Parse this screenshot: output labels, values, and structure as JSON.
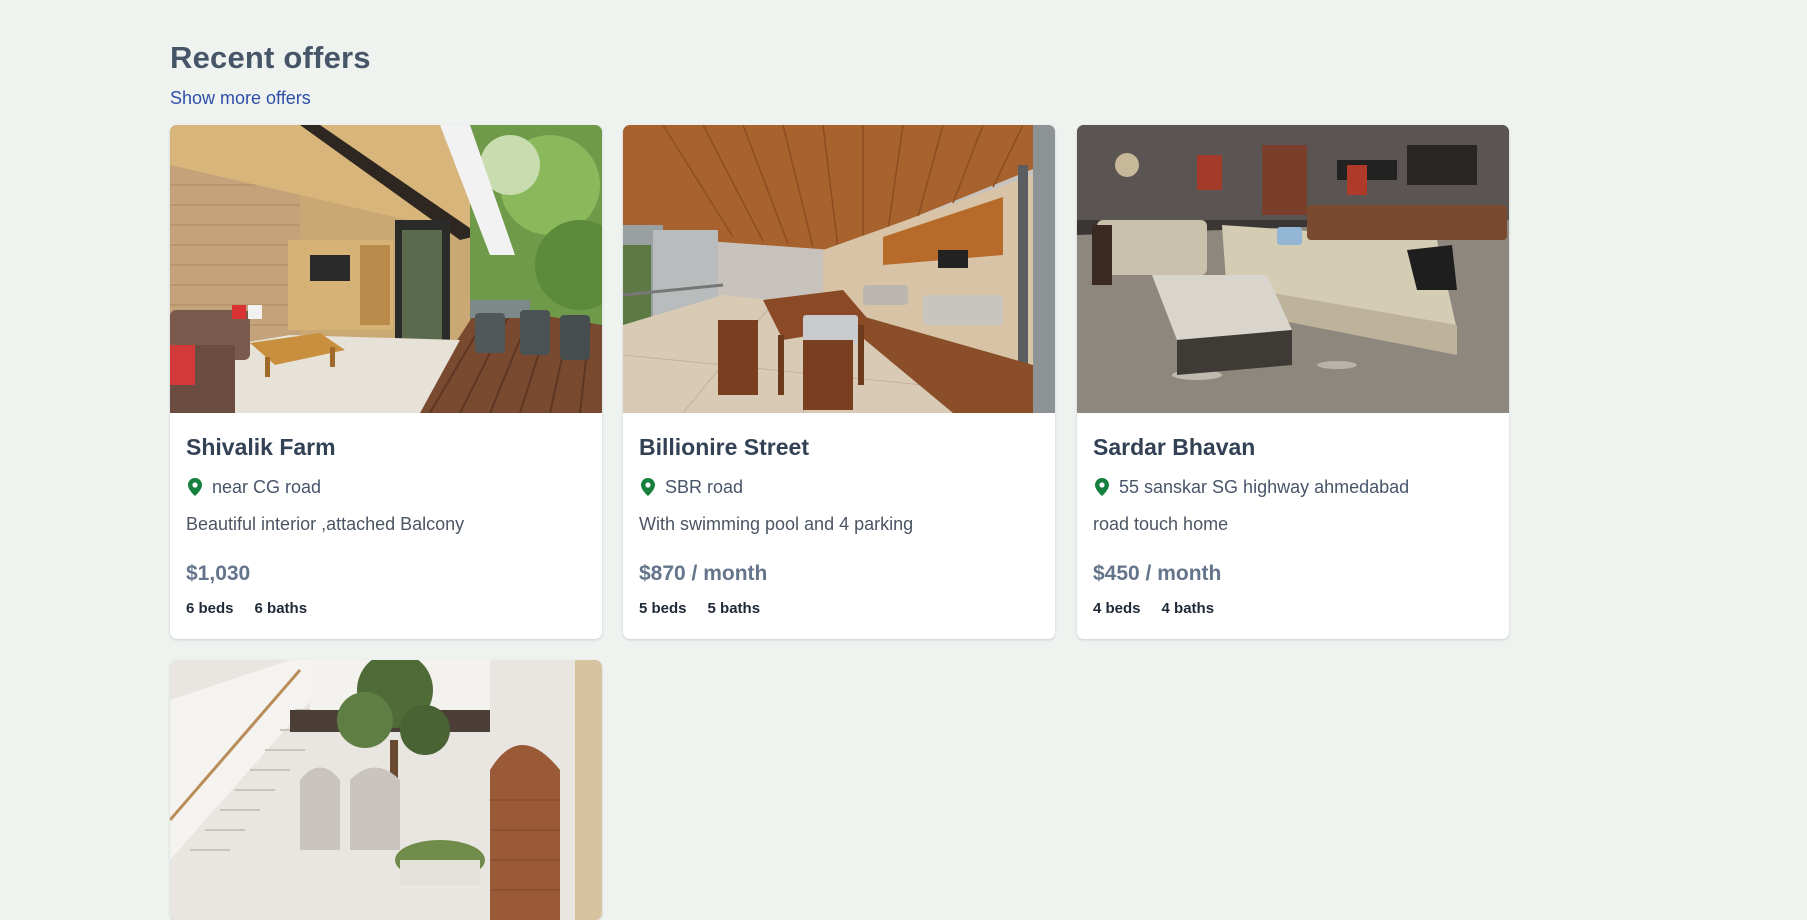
{
  "section": {
    "title": "Recent offers",
    "more_link": "Show more offers"
  },
  "offers": [
    {
      "title": "Shivalik Farm",
      "location": "near CG road",
      "description": "Beautiful interior ,attached Balcony",
      "price": "$1,030",
      "beds": "6 beds",
      "baths": "6 baths",
      "icon": "map-pin-icon"
    },
    {
      "title": "Billionire Street",
      "location": "SBR road",
      "description": "With swimming pool and 4 parking",
      "price": "$870 / month",
      "beds": "5 beds",
      "baths": "5 baths",
      "icon": "map-pin-icon"
    },
    {
      "title": "Sardar Bhavan",
      "location": "55 sanskar SG highway ahmedabad",
      "description": "road touch home",
      "price": "$450 / month",
      "beds": "4 beds",
      "baths": "4 baths",
      "icon": "map-pin-icon"
    },
    {
      "title": "",
      "location": "",
      "description": "",
      "price": "",
      "beds": "",
      "baths": ""
    }
  ],
  "colors": {
    "page_background": "#eff3f0",
    "link": "#2f4ea8",
    "pin": "#15803d",
    "card": "#ffffff"
  }
}
